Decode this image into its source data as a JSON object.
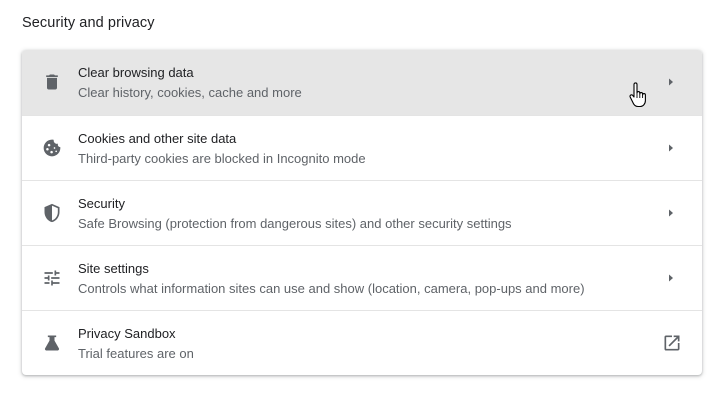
{
  "section": {
    "title": "Security and privacy"
  },
  "rows": [
    {
      "label": "Clear browsing data",
      "sublabel": "Clear history, cookies, cache and more",
      "icon": "trash-icon",
      "action": "chevron-right-icon",
      "hovered": true
    },
    {
      "label": "Cookies and other site data",
      "sublabel": "Third-party cookies are blocked in Incognito mode",
      "icon": "cookie-icon",
      "action": "chevron-right-icon"
    },
    {
      "label": "Security",
      "sublabel": "Safe Browsing (protection from dangerous sites) and other security settings",
      "icon": "shield-icon",
      "action": "chevron-right-icon"
    },
    {
      "label": "Site settings",
      "sublabel": "Controls what information sites can use and show (location, camera, pop-ups and more)",
      "icon": "tune-sliders-icon",
      "action": "chevron-right-icon"
    },
    {
      "label": "Privacy Sandbox",
      "sublabel": "Trial features are on",
      "icon": "flask-icon",
      "action": "open-in-new-icon"
    }
  ],
  "colors": {
    "icon": "#5f6368",
    "text_primary": "#202124",
    "text_secondary": "#5f6368",
    "hover_background": "#e6e6e6"
  }
}
